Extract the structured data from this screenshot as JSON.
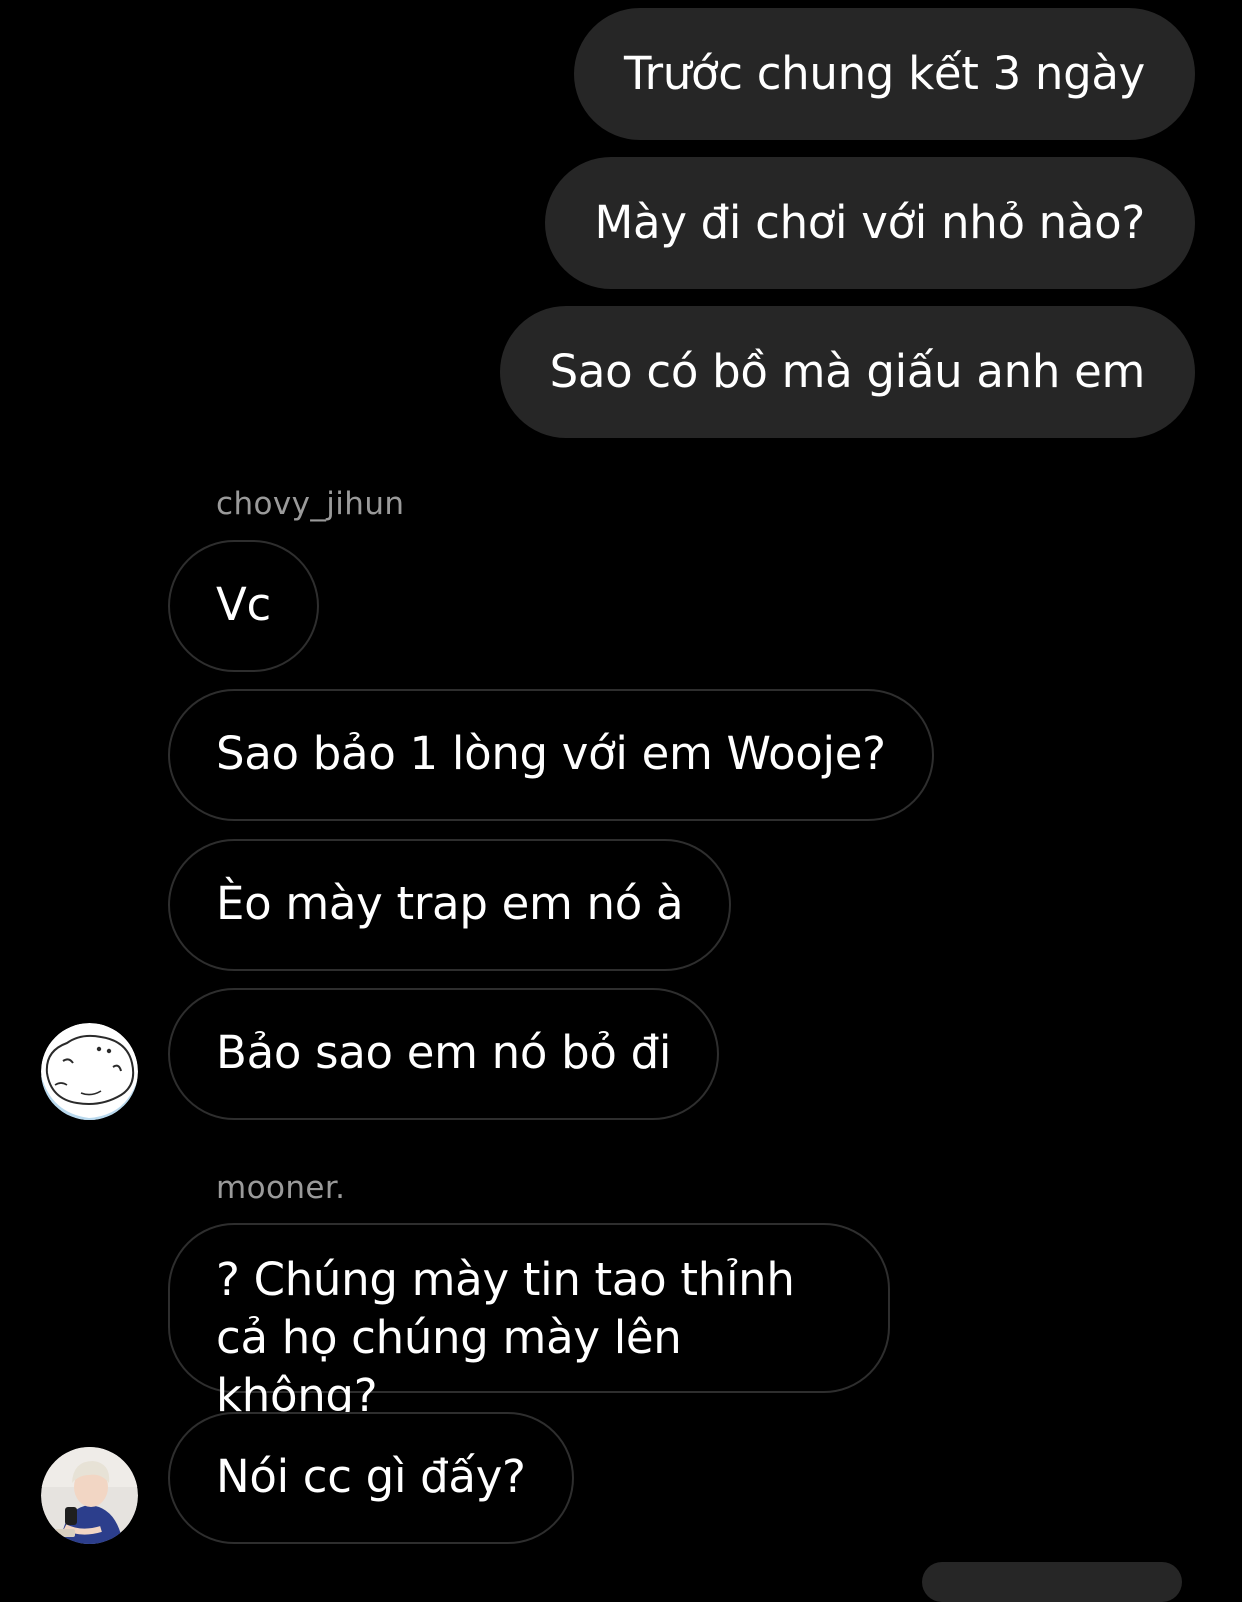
{
  "outgoing": [
    {
      "text": "Trước chung kết 3 ngày"
    },
    {
      "text": "Mày đi chơi với nhỏ nào?"
    },
    {
      "text": "Sao có bồ mà giấu anh em"
    }
  ],
  "group1": {
    "sender": "chovy_jihun",
    "avatar_icon": "cartoon-blob-avatar",
    "messages": [
      {
        "text": "Vc"
      },
      {
        "text": "Sao bảo 1 lòng với em Wooje?"
      },
      {
        "text": "Èo mày trap em nó à"
      },
      {
        "text": "Bảo sao em nó bỏ đi"
      }
    ]
  },
  "group2": {
    "sender": "mooner.",
    "avatar_icon": "person-photo-avatar",
    "messages": [
      {
        "text": "? Chúng mày tin tao thỉnh cả họ chúng mày lên không?"
      },
      {
        "text": "Nói cc gì đấy?"
      }
    ]
  },
  "colors": {
    "background": "#000000",
    "outgoing_bubble": "#262626",
    "incoming_border": "#2e2e2e",
    "sender_label": "#9a9a9a",
    "text": "#ffffff"
  }
}
